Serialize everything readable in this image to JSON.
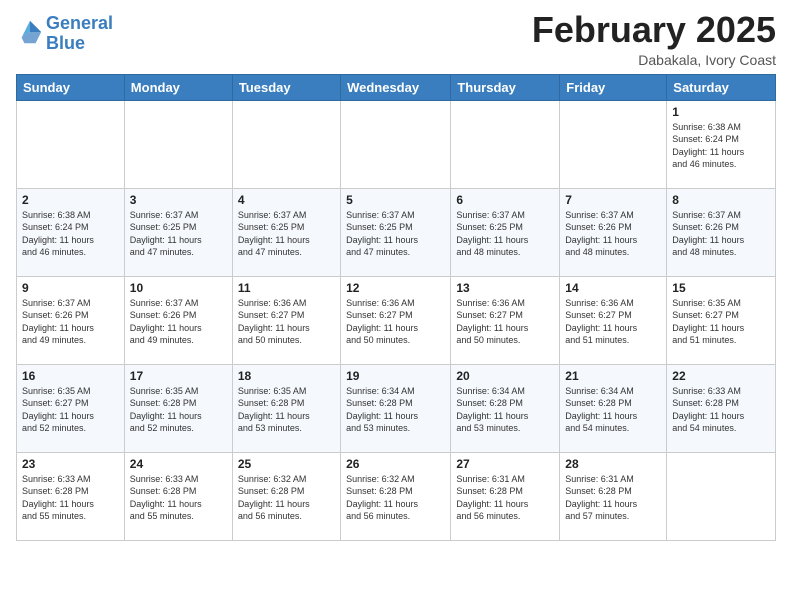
{
  "header": {
    "logo_line1": "General",
    "logo_line2": "Blue",
    "month_year": "February 2025",
    "location": "Dabakala, Ivory Coast"
  },
  "weekdays": [
    "Sunday",
    "Monday",
    "Tuesday",
    "Wednesday",
    "Thursday",
    "Friday",
    "Saturday"
  ],
  "weeks": [
    [
      {
        "day": "",
        "info": ""
      },
      {
        "day": "",
        "info": ""
      },
      {
        "day": "",
        "info": ""
      },
      {
        "day": "",
        "info": ""
      },
      {
        "day": "",
        "info": ""
      },
      {
        "day": "",
        "info": ""
      },
      {
        "day": "1",
        "info": "Sunrise: 6:38 AM\nSunset: 6:24 PM\nDaylight: 11 hours\nand 46 minutes."
      }
    ],
    [
      {
        "day": "2",
        "info": "Sunrise: 6:38 AM\nSunset: 6:24 PM\nDaylight: 11 hours\nand 46 minutes."
      },
      {
        "day": "3",
        "info": "Sunrise: 6:37 AM\nSunset: 6:25 PM\nDaylight: 11 hours\nand 47 minutes."
      },
      {
        "day": "4",
        "info": "Sunrise: 6:37 AM\nSunset: 6:25 PM\nDaylight: 11 hours\nand 47 minutes."
      },
      {
        "day": "5",
        "info": "Sunrise: 6:37 AM\nSunset: 6:25 PM\nDaylight: 11 hours\nand 47 minutes."
      },
      {
        "day": "6",
        "info": "Sunrise: 6:37 AM\nSunset: 6:25 PM\nDaylight: 11 hours\nand 48 minutes."
      },
      {
        "day": "7",
        "info": "Sunrise: 6:37 AM\nSunset: 6:26 PM\nDaylight: 11 hours\nand 48 minutes."
      },
      {
        "day": "8",
        "info": "Sunrise: 6:37 AM\nSunset: 6:26 PM\nDaylight: 11 hours\nand 48 minutes."
      }
    ],
    [
      {
        "day": "9",
        "info": "Sunrise: 6:37 AM\nSunset: 6:26 PM\nDaylight: 11 hours\nand 49 minutes."
      },
      {
        "day": "10",
        "info": "Sunrise: 6:37 AM\nSunset: 6:26 PM\nDaylight: 11 hours\nand 49 minutes."
      },
      {
        "day": "11",
        "info": "Sunrise: 6:36 AM\nSunset: 6:27 PM\nDaylight: 11 hours\nand 50 minutes."
      },
      {
        "day": "12",
        "info": "Sunrise: 6:36 AM\nSunset: 6:27 PM\nDaylight: 11 hours\nand 50 minutes."
      },
      {
        "day": "13",
        "info": "Sunrise: 6:36 AM\nSunset: 6:27 PM\nDaylight: 11 hours\nand 50 minutes."
      },
      {
        "day": "14",
        "info": "Sunrise: 6:36 AM\nSunset: 6:27 PM\nDaylight: 11 hours\nand 51 minutes."
      },
      {
        "day": "15",
        "info": "Sunrise: 6:35 AM\nSunset: 6:27 PM\nDaylight: 11 hours\nand 51 minutes."
      }
    ],
    [
      {
        "day": "16",
        "info": "Sunrise: 6:35 AM\nSunset: 6:27 PM\nDaylight: 11 hours\nand 52 minutes."
      },
      {
        "day": "17",
        "info": "Sunrise: 6:35 AM\nSunset: 6:28 PM\nDaylight: 11 hours\nand 52 minutes."
      },
      {
        "day": "18",
        "info": "Sunrise: 6:35 AM\nSunset: 6:28 PM\nDaylight: 11 hours\nand 53 minutes."
      },
      {
        "day": "19",
        "info": "Sunrise: 6:34 AM\nSunset: 6:28 PM\nDaylight: 11 hours\nand 53 minutes."
      },
      {
        "day": "20",
        "info": "Sunrise: 6:34 AM\nSunset: 6:28 PM\nDaylight: 11 hours\nand 53 minutes."
      },
      {
        "day": "21",
        "info": "Sunrise: 6:34 AM\nSunset: 6:28 PM\nDaylight: 11 hours\nand 54 minutes."
      },
      {
        "day": "22",
        "info": "Sunrise: 6:33 AM\nSunset: 6:28 PM\nDaylight: 11 hours\nand 54 minutes."
      }
    ],
    [
      {
        "day": "23",
        "info": "Sunrise: 6:33 AM\nSunset: 6:28 PM\nDaylight: 11 hours\nand 55 minutes."
      },
      {
        "day": "24",
        "info": "Sunrise: 6:33 AM\nSunset: 6:28 PM\nDaylight: 11 hours\nand 55 minutes."
      },
      {
        "day": "25",
        "info": "Sunrise: 6:32 AM\nSunset: 6:28 PM\nDaylight: 11 hours\nand 56 minutes."
      },
      {
        "day": "26",
        "info": "Sunrise: 6:32 AM\nSunset: 6:28 PM\nDaylight: 11 hours\nand 56 minutes."
      },
      {
        "day": "27",
        "info": "Sunrise: 6:31 AM\nSunset: 6:28 PM\nDaylight: 11 hours\nand 56 minutes."
      },
      {
        "day": "28",
        "info": "Sunrise: 6:31 AM\nSunset: 6:28 PM\nDaylight: 11 hours\nand 57 minutes."
      },
      {
        "day": "",
        "info": ""
      }
    ]
  ]
}
